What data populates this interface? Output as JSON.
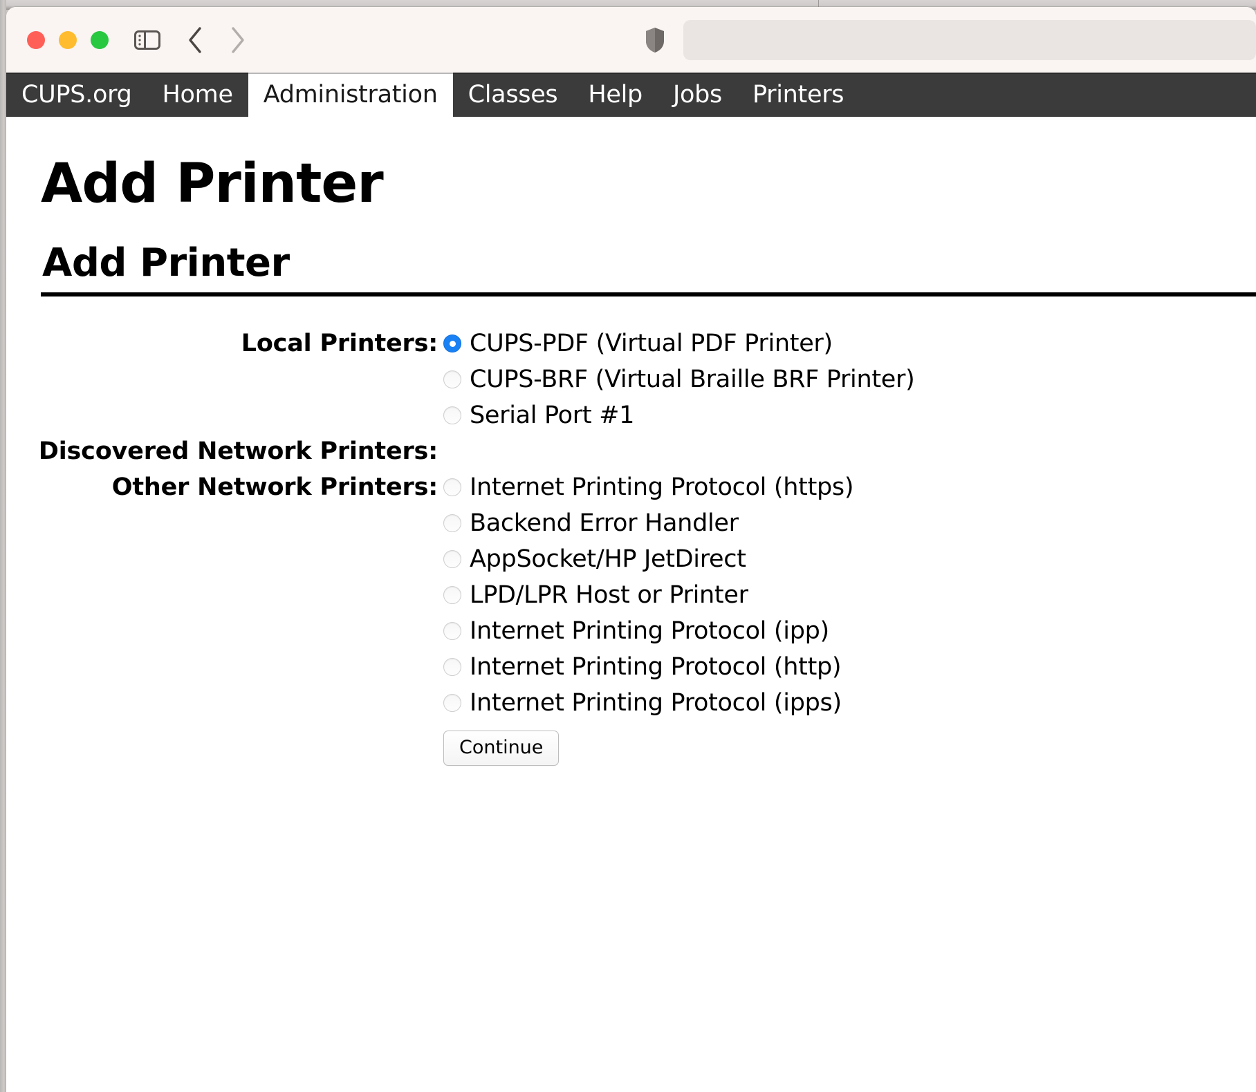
{
  "window": {
    "traffic_lights": [
      "close",
      "minimize",
      "zoom"
    ],
    "toolbar": {
      "sidebar_toggle_name": "sidebar-toggle-icon",
      "back_label": "Back",
      "forward_label": "Forward",
      "shield_label": "Privacy Report",
      "address_value": "",
      "address_placeholder": ""
    }
  },
  "nav": {
    "items": [
      {
        "label": "CUPS.org",
        "active": false
      },
      {
        "label": "Home",
        "active": false
      },
      {
        "label": "Administration",
        "active": true
      },
      {
        "label": "Classes",
        "active": false
      },
      {
        "label": "Help",
        "active": false
      },
      {
        "label": "Jobs",
        "active": false
      },
      {
        "label": "Printers",
        "active": false
      }
    ]
  },
  "page": {
    "title": "Add Printer",
    "section_heading": "Add Printer"
  },
  "form": {
    "rows": [
      {
        "label": "Local Printers:",
        "options": [
          {
            "label": "CUPS-PDF (Virtual PDF Printer)",
            "selected": true
          },
          {
            "label": "CUPS-BRF (Virtual Braille BRF Printer)",
            "selected": false
          },
          {
            "label": "Serial Port #1",
            "selected": false
          }
        ]
      },
      {
        "label": "Discovered Network Printers:",
        "options": []
      },
      {
        "label": "Other Network Printers:",
        "options": [
          {
            "label": "Internet Printing Protocol (https)",
            "selected": false
          },
          {
            "label": "Backend Error Handler",
            "selected": false
          },
          {
            "label": "AppSocket/HP JetDirect",
            "selected": false
          },
          {
            "label": "LPD/LPR Host or Printer",
            "selected": false
          },
          {
            "label": "Internet Printing Protocol (ipp)",
            "selected": false
          },
          {
            "label": "Internet Printing Protocol (http)",
            "selected": false
          },
          {
            "label": "Internet Printing Protocol (ipps)",
            "selected": false
          }
        ]
      }
    ],
    "continue_label": "Continue"
  },
  "colors": {
    "nav_background": "#3b3b3b",
    "nav_active_background": "#ffffff",
    "radio_selected": "#1a81f5",
    "toolbar_background": "#faf4f3",
    "traffic_red": "#ff5f57",
    "traffic_yellow": "#febc2e",
    "traffic_green": "#28c840"
  }
}
